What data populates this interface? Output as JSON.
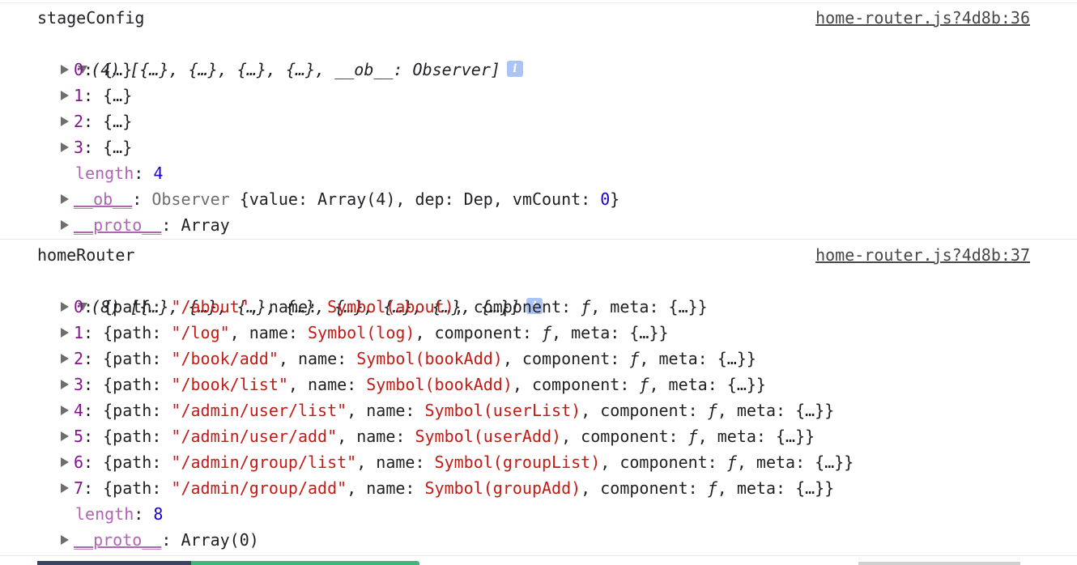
{
  "messages": [
    {
      "label": "stageConfig",
      "source": "home-router.js?4d8b:36",
      "summary": "(4) [{…}, {…}, {…}, {…}, __ob__: Observer]",
      "items": [
        {
          "index": "0",
          "value": "{…}"
        },
        {
          "index": "1",
          "value": "{…}"
        },
        {
          "index": "2",
          "value": "{…}"
        },
        {
          "index": "3",
          "value": "{…}"
        }
      ],
      "length_label": "length",
      "length_value": "4",
      "ob_label": "__ob__",
      "ob_value": "Observer {value: Array(4), dep: Dep, vmCount: 0}",
      "proto_label": "__proto__",
      "proto_value": "Array"
    },
    {
      "label": "homeRouter",
      "source": "home-router.js?4d8b:37",
      "summary": "(8) [{…}, {…}, {…}, {…}, {…}, {…}, {…}, {…}]",
      "items": [
        {
          "index": "0",
          "path": "\"/about\"",
          "name": "Symbol(about)"
        },
        {
          "index": "1",
          "path": "\"/log\"",
          "name": "Symbol(log)"
        },
        {
          "index": "2",
          "path": "\"/book/add\"",
          "name": "Symbol(bookAdd)"
        },
        {
          "index": "3",
          "path": "\"/book/list\"",
          "name": "Symbol(bookAdd)"
        },
        {
          "index": "4",
          "path": "\"/admin/user/list\"",
          "name": "Symbol(userList)"
        },
        {
          "index": "5",
          "path": "\"/admin/user/add\"",
          "name": "Symbol(userAdd)"
        },
        {
          "index": "6",
          "path": "\"/admin/group/list\"",
          "name": "Symbol(groupList)"
        },
        {
          "index": "7",
          "path": "\"/admin/group/add\"",
          "name": "Symbol(groupAdd)"
        }
      ],
      "length_label": "length",
      "length_value": "8",
      "proto_label": "__proto__",
      "proto_value": "Array(0)"
    }
  ],
  "info_badge": "i",
  "colors": {
    "key": "#881391",
    "string": "#c41a16",
    "number": "#1c00cf",
    "info_badge": "#a9c4f5"
  }
}
